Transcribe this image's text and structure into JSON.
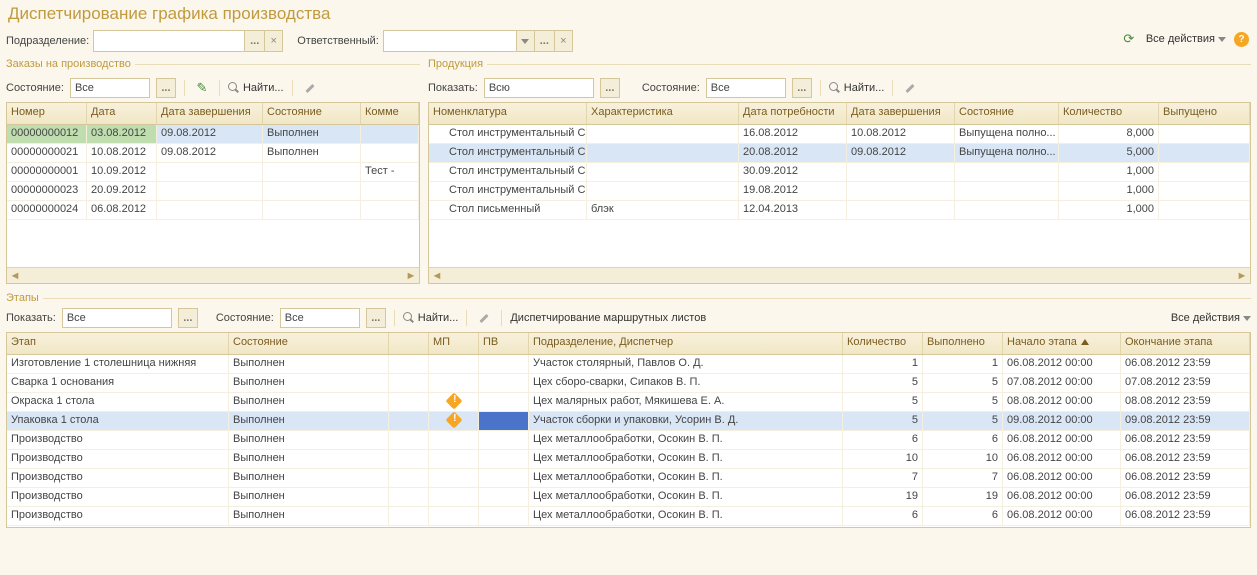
{
  "title": "Диспетчирование графика производства",
  "filters": {
    "subdivision_label": "Подразделение:",
    "responsible_label": "Ответственный:"
  },
  "top": {
    "all_actions": "Все действия"
  },
  "orders": {
    "legend": "Заказы на производство",
    "state_label": "Состояние:",
    "state_value": "Все",
    "find": "Найти...",
    "cols": {
      "num": "Номер",
      "date": "Дата",
      "done": "Дата завершения",
      "state": "Состояние",
      "comment": "Комме"
    },
    "rows": [
      {
        "num": "00000000012",
        "date": "03.08.2012",
        "done": "09.08.2012",
        "state": "Выполнен",
        "comment": "",
        "sel": true,
        "green": true
      },
      {
        "num": "00000000021",
        "date": "10.08.2012",
        "done": "09.08.2012",
        "state": "Выполнен",
        "comment": ""
      },
      {
        "num": "00000000001",
        "date": "10.09.2012",
        "done": "",
        "state": "",
        "comment": "Тест -"
      },
      {
        "num": "00000000023",
        "date": "20.09.2012",
        "done": "",
        "state": "",
        "comment": ""
      },
      {
        "num": "00000000024",
        "date": "06.08.2012",
        "done": "",
        "state": "",
        "comment": ""
      }
    ]
  },
  "products": {
    "legend": "Продукция",
    "show_label": "Показать:",
    "show_value": "Всю",
    "state_label": "Состояние:",
    "state_value": "Все",
    "find": "Найти...",
    "cols": {
      "nom": "Номенклатура",
      "char": "Характеристика",
      "need": "Дата потребности",
      "done": "Дата завершения",
      "state": "Состояние",
      "qty": "Количество",
      "out": "Выпущено"
    },
    "rows": [
      {
        "nom": "Стол инструментальный СИ...",
        "char": "",
        "need": "16.08.2012",
        "done": "10.08.2012",
        "state": "Выпущена полно...",
        "qty": "8,000",
        "out": ""
      },
      {
        "nom": "Стол инструментальный СИ...",
        "char": "",
        "need": "20.08.2012",
        "done": "09.08.2012",
        "state": "Выпущена полно...",
        "qty": "5,000",
        "out": "",
        "sel": true
      },
      {
        "nom": "Стол инструментальный СИ...",
        "char": "",
        "need": "30.09.2012",
        "done": "",
        "state": "",
        "qty": "1,000",
        "out": ""
      },
      {
        "nom": "Стол инструментальный СИ...",
        "char": "",
        "need": "19.08.2012",
        "done": "",
        "state": "",
        "qty": "1,000",
        "out": ""
      },
      {
        "nom": "Стол письменный",
        "char": "блэк",
        "need": "12.04.2013",
        "done": "",
        "state": "",
        "qty": "1,000",
        "out": ""
      }
    ]
  },
  "stages": {
    "legend": "Этапы",
    "show_label": "Показать:",
    "show_value": "Все",
    "state_label": "Состояние:",
    "state_value": "Все",
    "find": "Найти...",
    "dispatch": "Диспетчирование маршрутных листов",
    "all_actions": "Все действия",
    "cols": {
      "stage": "Этап",
      "state": "Состояние",
      "blank": "",
      "mp": "МП",
      "pv": "ПВ",
      "dept": "Подразделение, Диспетчер",
      "qty": "Количество",
      "done": "Выполнено",
      "start": "Начало этапа",
      "end": "Окончание этапа"
    },
    "rows": [
      {
        "stage": "Изготовление 1 столешница нижняя",
        "state": "Выполнен",
        "mp": "",
        "pv": "",
        "dept": "Участок столярный, Павлов О. Д.",
        "qty": "1",
        "done": "1",
        "start": "06.08.2012 00:00",
        "end": "06.08.2012 23:59"
      },
      {
        "stage": "Сварка 1 основания",
        "state": "Выполнен",
        "mp": "",
        "pv": "",
        "dept": "Цех сборо-сварки, Сипаков В. П.",
        "qty": "5",
        "done": "5",
        "start": "07.08.2012 00:00",
        "end": "07.08.2012 23:59"
      },
      {
        "stage": "Окраска 1 стола",
        "state": "Выполнен",
        "mp": "warn",
        "pv": "",
        "dept": "Цех малярных работ, Мякишева Е. А.",
        "qty": "5",
        "done": "5",
        "start": "08.08.2012 00:00",
        "end": "08.08.2012 23:59"
      },
      {
        "stage": "Упаковка 1 стола",
        "state": "Выполнен",
        "mp": "warn",
        "pv": "blue",
        "dept": "Участок сборки и упаковки, Усорин В. Д.",
        "qty": "5",
        "done": "5",
        "start": "09.08.2012 00:00",
        "end": "09.08.2012 23:59",
        "sel": true
      },
      {
        "stage": "Производство",
        "state": "Выполнен",
        "mp": "",
        "pv": "",
        "dept": "Цех металлообработки, Осокин В. П.",
        "qty": "6",
        "done": "6",
        "start": "06.08.2012 00:00",
        "end": "06.08.2012 23:59"
      },
      {
        "stage": "Производство",
        "state": "Выполнен",
        "mp": "",
        "pv": "",
        "dept": "Цех металлообработки, Осокин В. П.",
        "qty": "10",
        "done": "10",
        "start": "06.08.2012 00:00",
        "end": "06.08.2012 23:59"
      },
      {
        "stage": "Производство",
        "state": "Выполнен",
        "mp": "",
        "pv": "",
        "dept": "Цех металлообработки, Осокин В. П.",
        "qty": "7",
        "done": "7",
        "start": "06.08.2012 00:00",
        "end": "06.08.2012 23:59"
      },
      {
        "stage": "Производство",
        "state": "Выполнен",
        "mp": "",
        "pv": "",
        "dept": "Цех металлообработки, Осокин В. П.",
        "qty": "19",
        "done": "19",
        "start": "06.08.2012 00:00",
        "end": "06.08.2012 23:59"
      },
      {
        "stage": "Производство",
        "state": "Выполнен",
        "mp": "",
        "pv": "",
        "dept": "Цех металлообработки, Осокин В. П.",
        "qty": "6",
        "done": "6",
        "start": "06.08.2012 00:00",
        "end": "06.08.2012 23:59"
      }
    ]
  }
}
